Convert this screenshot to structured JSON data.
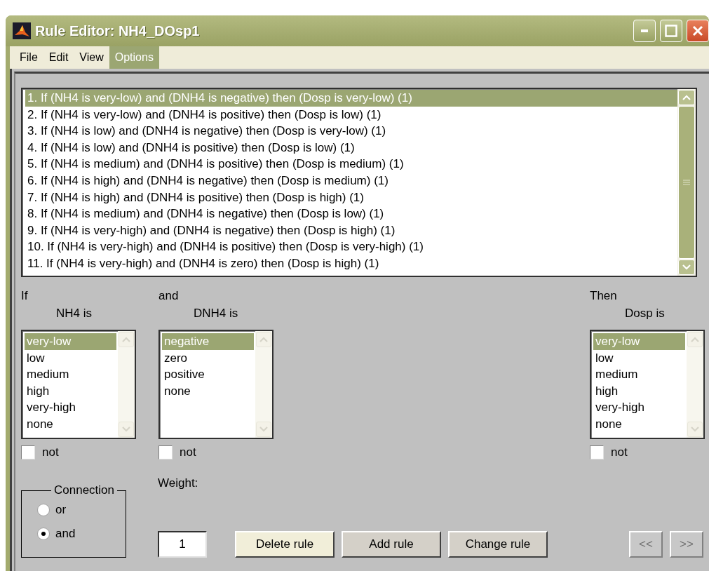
{
  "window": {
    "title": "Rule Editor: NH4_DOsp1"
  },
  "menu": [
    {
      "label": "File",
      "selected": false
    },
    {
      "label": "Edit",
      "selected": false
    },
    {
      "label": "View",
      "selected": false
    },
    {
      "label": "Options",
      "selected": true
    }
  ],
  "rules": [
    {
      "text": "1. If (NH4 is very-low) and (DNH4 is negative) then (Dosp is very-low) (1)",
      "selected": true
    },
    {
      "text": "2. If (NH4 is very-low) and (DNH4 is positive) then (Dosp is low) (1)",
      "selected": false
    },
    {
      "text": "3. If (NH4 is low) and (DNH4 is negative) then (Dosp is very-low) (1)",
      "selected": false
    },
    {
      "text": "4. If (NH4 is low) and (DNH4 is positive) then (Dosp is low) (1)",
      "selected": false
    },
    {
      "text": "5. If (NH4 is medium) and (DNH4 is positive) then (Dosp is medium) (1)",
      "selected": false
    },
    {
      "text": "6. If (NH4 is high) and (DNH4 is negative) then (Dosp is medium) (1)",
      "selected": false
    },
    {
      "text": "7. If (NH4 is high) and (DNH4 is positive) then (Dosp is high) (1)",
      "selected": false
    },
    {
      "text": "8. If (NH4 is medium) and (DNH4 is negative) then (Dosp is low) (1)",
      "selected": false
    },
    {
      "text": "9. If (NH4 is very-high) and (DNH4 is negative) then (Dosp is high) (1)",
      "selected": false
    },
    {
      "text": "10. If (NH4 is very-high) and (DNH4 is positive) then (Dosp is very-high) (1)",
      "selected": false
    },
    {
      "text": "11. If (NH4 is very-high) and (DNH4 is zero) then (Dosp is high) (1)",
      "selected": false
    }
  ],
  "variables": [
    {
      "kind": "input",
      "heading": "If",
      "name": "NH4 is",
      "not_label": "not",
      "not_checked": false,
      "items": [
        {
          "label": "very-low",
          "selected": true
        },
        {
          "label": "low",
          "selected": false
        },
        {
          "label": "medium",
          "selected": false
        },
        {
          "label": "high",
          "selected": false
        },
        {
          "label": "very-high",
          "selected": false
        },
        {
          "label": "none",
          "selected": false
        }
      ]
    },
    {
      "kind": "input",
      "heading": "and",
      "name": "DNH4 is",
      "not_label": "not",
      "not_checked": false,
      "items": [
        {
          "label": "negative",
          "selected": true
        },
        {
          "label": "zero",
          "selected": false
        },
        {
          "label": "positive",
          "selected": false
        },
        {
          "label": "none",
          "selected": false
        }
      ]
    },
    {
      "kind": "output",
      "heading": "Then",
      "name": "Dosp is",
      "not_label": "not",
      "not_checked": false,
      "items": [
        {
          "label": "very-low",
          "selected": true
        },
        {
          "label": "low",
          "selected": false
        },
        {
          "label": "medium",
          "selected": false
        },
        {
          "label": "high",
          "selected": false
        },
        {
          "label": "very-high",
          "selected": false
        },
        {
          "label": "none",
          "selected": false
        }
      ]
    }
  ],
  "connection": {
    "title": "Connection",
    "options": [
      {
        "label": "or",
        "selected": false
      },
      {
        "label": "and",
        "selected": true
      }
    ]
  },
  "weight": {
    "label": "Weight:",
    "value": "1"
  },
  "buttons": [
    {
      "label": "Delete rule",
      "kind": "default"
    },
    {
      "label": "Add rule",
      "kind": "normal"
    },
    {
      "label": "Change rule",
      "kind": "normal"
    }
  ],
  "nav": [
    {
      "label": "<<",
      "disabled": true
    },
    {
      "label": ">>",
      "disabled": true
    }
  ]
}
